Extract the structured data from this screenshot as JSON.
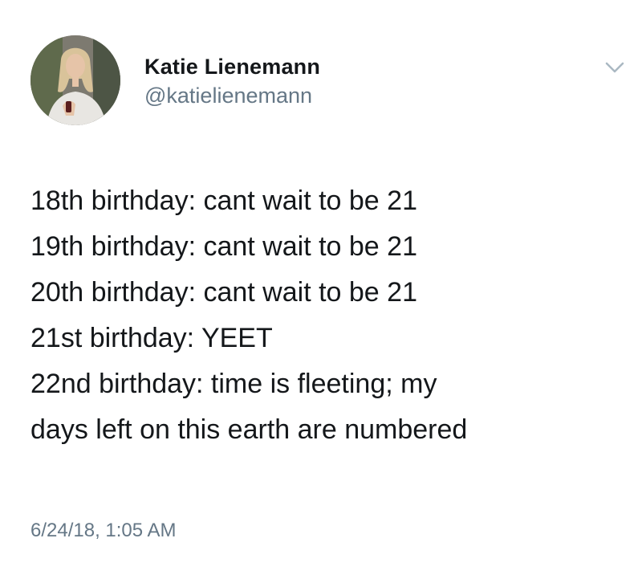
{
  "author": {
    "display_name": "Katie Lienemann",
    "handle": "@katielienemann",
    "avatar": "profile-photo"
  },
  "menu_icon": "chevron-down-icon",
  "tweet": {
    "lines": [
      "18th birthday: cant wait to be 21",
      "19th birthday: cant wait to be 21",
      "20th birthday: cant wait to be 21",
      "21st birthday: YEET",
      "22nd birthday: time is fleeting; my",
      "days left on this earth are numbered"
    ],
    "timestamp": "6/24/18, 1:05 AM"
  },
  "colors": {
    "text_primary": "#14171a",
    "text_secondary": "#657786",
    "chevron": "#aab8c2",
    "background": "#ffffff"
  }
}
